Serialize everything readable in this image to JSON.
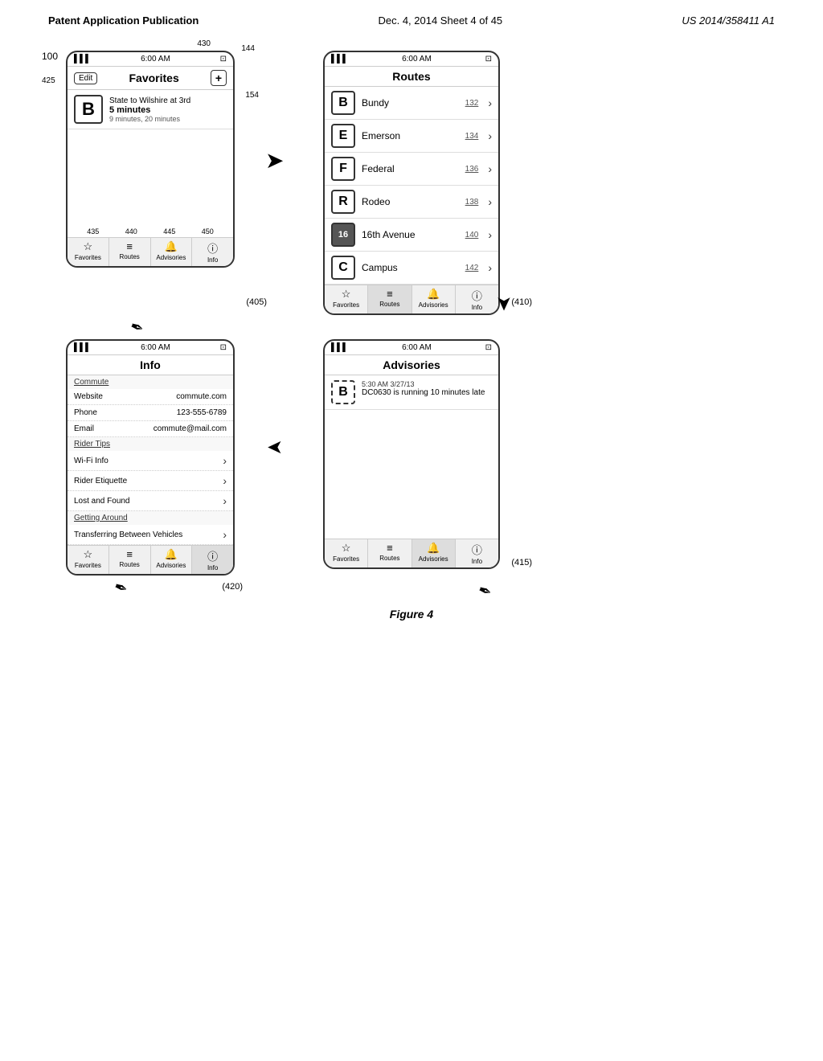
{
  "header": {
    "left": "Patent Application Publication",
    "center": "Dec. 4, 2014    Sheet 4 of 45",
    "right": "US 2014/358411 A1"
  },
  "figure": {
    "label": "Figure 4",
    "outer_ref": "100"
  },
  "phone_favorites": {
    "status": {
      "signal": "▌▌▌",
      "time": "6:00 AM",
      "battery": "▓▓"
    },
    "edit_label": "Edit",
    "title": "Favorites",
    "add_label": "+",
    "route": {
      "icon": "B",
      "description": "State to Wilshire at 3rd",
      "time_bold": "5 minutes",
      "time_normal": "9 minutes, 20 minutes"
    },
    "ref_edit": "425",
    "ref_add": "430",
    "ref_arrow": "144",
    "ref_item": "154",
    "tabs": [
      {
        "icon": "☆",
        "label": "Favorites",
        "active": false
      },
      {
        "icon": "≡",
        "label": "Routes",
        "active": false
      },
      {
        "icon": "🔔",
        "label": "Advisories",
        "active": false
      },
      {
        "icon": "ⓘ",
        "label": "Info",
        "active": false
      }
    ],
    "tab_refs": [
      "435",
      "440",
      "445",
      "450"
    ],
    "panel_ref": "405"
  },
  "phone_routes": {
    "status": {
      "signal": "▌▌▌",
      "time": "6:00 AM",
      "battery": "▓▓"
    },
    "title": "Routes",
    "routes": [
      {
        "icon": "B",
        "name": "Bundy",
        "number": "132",
        "numbered": false
      },
      {
        "icon": "E",
        "name": "Emerson",
        "number": "134",
        "numbered": false
      },
      {
        "icon": "F",
        "name": "Federal",
        "number": "136",
        "numbered": false
      },
      {
        "icon": "R",
        "name": "Rodeo",
        "number": "138",
        "numbered": false
      },
      {
        "icon": "16",
        "name": "16th Avenue",
        "number": "140",
        "numbered": true
      },
      {
        "icon": "C",
        "name": "Campus",
        "number": "142",
        "numbered": false
      }
    ],
    "tabs": [
      {
        "icon": "☆",
        "label": "Favorites",
        "active": false
      },
      {
        "icon": "≡",
        "label": "Routes",
        "active": true
      },
      {
        "icon": "🔔",
        "label": "Advisories",
        "active": false
      },
      {
        "icon": "ⓘ",
        "label": "Info",
        "active": false
      }
    ],
    "panel_ref": "410"
  },
  "phone_info": {
    "status": {
      "signal": "▌▌▌",
      "time": "6:00 AM",
      "battery": "▓▓"
    },
    "title": "Info",
    "sections": [
      {
        "header": "Commute",
        "rows": [
          {
            "label": "Website",
            "value": "commute.com",
            "link": false
          },
          {
            "label": "Phone",
            "value": "123-555-6789",
            "link": false
          },
          {
            "label": "Email",
            "value": "commute@mail.com",
            "link": false
          }
        ]
      },
      {
        "header": "Rider Tips",
        "rows": [
          {
            "label": "Wi-Fi Info",
            "value": "",
            "link": true
          },
          {
            "label": "Rider Etiquette",
            "value": "",
            "link": true
          },
          {
            "label": "Lost and Found",
            "value": "",
            "link": true
          }
        ]
      },
      {
        "header": "Getting Around",
        "rows": [
          {
            "label": "Transferring Between Vehicles",
            "value": "",
            "link": true
          }
        ]
      }
    ],
    "tabs": [
      {
        "icon": "☆",
        "label": "Favorites",
        "active": false
      },
      {
        "icon": "≡",
        "label": "Routes",
        "active": false
      },
      {
        "icon": "🔔",
        "label": "Advisories",
        "active": false
      },
      {
        "icon": "ⓘ",
        "label": "Info",
        "active": true
      }
    ],
    "panel_ref": "420"
  },
  "phone_advisories": {
    "status": {
      "signal": "▌▌▌",
      "time": "6:00 AM",
      "battery": "▓▓"
    },
    "title": "Advisories",
    "items": [
      {
        "icon": "B",
        "time": "5:30 AM 3/27/13",
        "message": "DC0630 is running 10 minutes late"
      }
    ],
    "tabs": [
      {
        "icon": "☆",
        "label": "Favorites",
        "active": false
      },
      {
        "icon": "≡",
        "label": "Routes",
        "active": false
      },
      {
        "icon": "🔔",
        "label": "Advisories",
        "active": true
      },
      {
        "icon": "ⓘ",
        "label": "Info",
        "active": false
      }
    ],
    "panel_ref": "415"
  }
}
